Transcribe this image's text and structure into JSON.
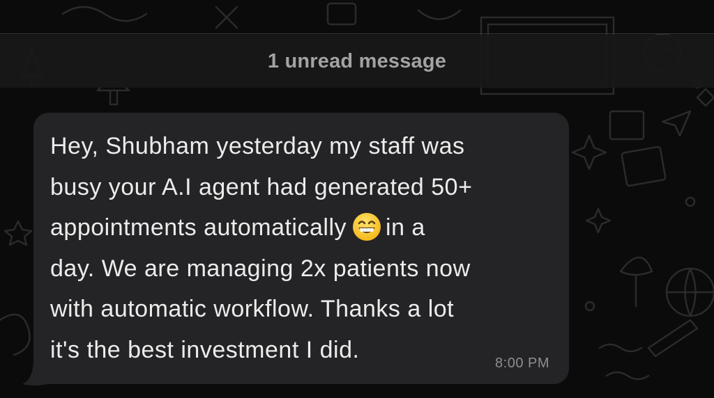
{
  "banner": {
    "unread_label": "1 unread message"
  },
  "message": {
    "lines": [
      "Hey, Shubham yesterday my staff was",
      "busy your A.I agent had generated 50+",
      "appointments automatically",
      "in a",
      "day. We are managing 2x patients now",
      "with automatic workflow. Thanks a lot",
      "it's the best investment I did."
    ],
    "emoji": "grinning-face-with-smiling-eyes",
    "time": "8:00 PM"
  },
  "colors": {
    "background": "#0b0b0b",
    "banner": "#181818",
    "bubble": "#242426",
    "message_text": "#ececec",
    "meta_text": "#8e8e93",
    "doodle": "#2a2a2c"
  }
}
